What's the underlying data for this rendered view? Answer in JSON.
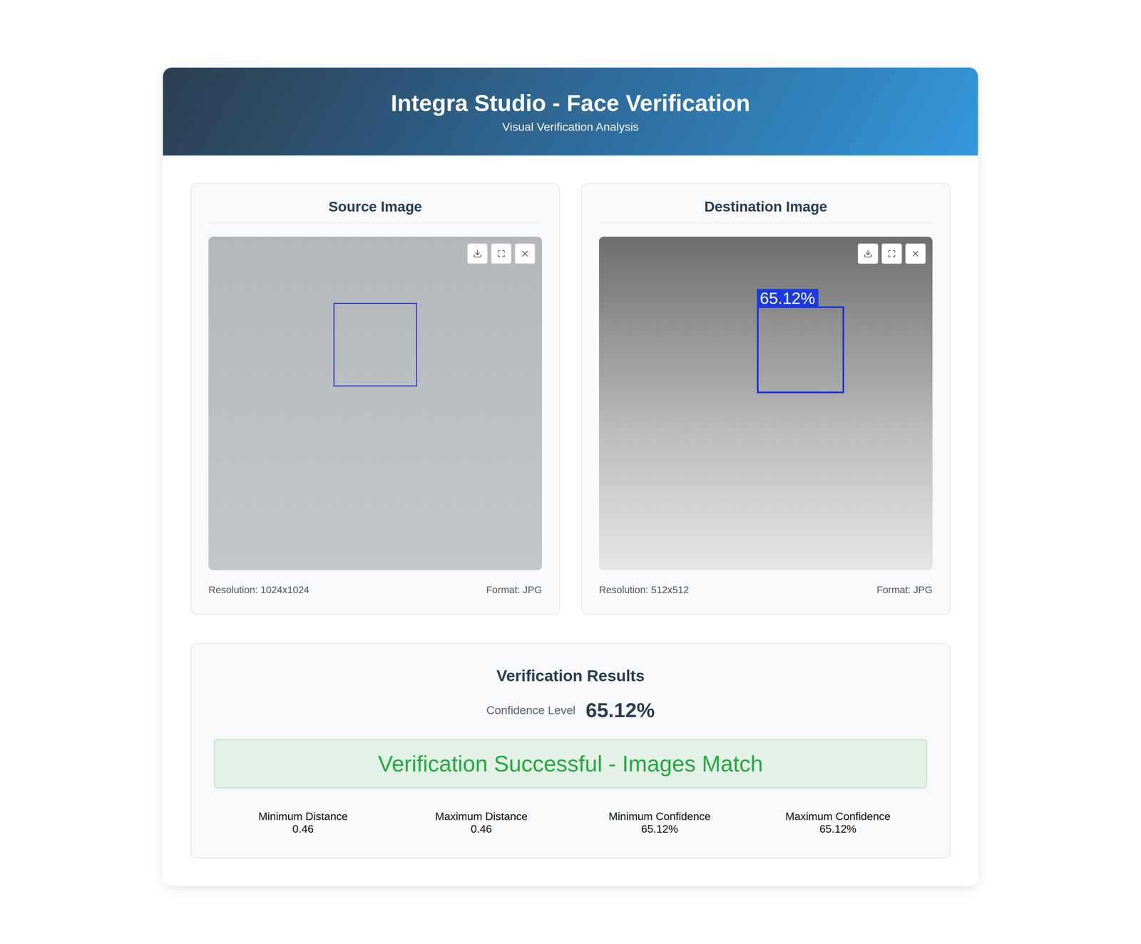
{
  "header": {
    "title": "Integra Studio - Face Verification",
    "subtitle": "Visual Verification Analysis"
  },
  "images": [
    {
      "title": "Source Image",
      "resolution": "Resolution: 1024x1024",
      "format": "Format: JPG",
      "face_label": ""
    },
    {
      "title": "Destination Image",
      "resolution": "Resolution: 512x512",
      "format": "Format: JPG",
      "face_label": "65.12%"
    }
  ],
  "results": {
    "title": "Verification Results",
    "confidence_label": "Confidence Level",
    "confidence_value": "65.12%",
    "status": "Verification Successful - Images Match",
    "success": true,
    "stats": [
      {
        "label": "Minimum Distance",
        "value": "0.46"
      },
      {
        "label": "Maximum Distance",
        "value": "0.46"
      },
      {
        "label": "Minimum Confidence",
        "value": "65.12%"
      },
      {
        "label": "Maximum Confidence",
        "value": "65.12%"
      }
    ]
  }
}
